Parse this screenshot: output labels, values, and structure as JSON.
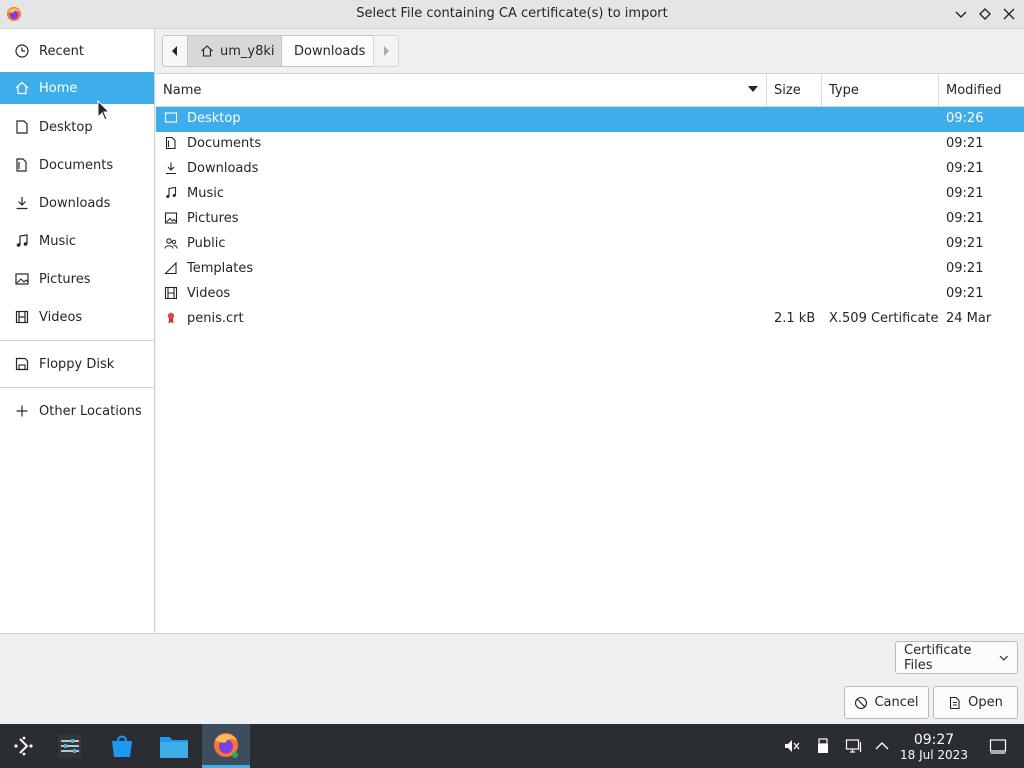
{
  "window": {
    "title": "Select File containing CA certificate(s) to import"
  },
  "sidebar": {
    "items": [
      {
        "label": "Recent",
        "icon": "clock-icon"
      },
      {
        "label": "Home",
        "icon": "home-icon"
      },
      {
        "label": "Desktop",
        "icon": "desktop-icon"
      },
      {
        "label": "Documents",
        "icon": "documents-icon"
      },
      {
        "label": "Downloads",
        "icon": "download-icon"
      },
      {
        "label": "Music",
        "icon": "music-icon"
      },
      {
        "label": "Pictures",
        "icon": "pictures-icon"
      },
      {
        "label": "Videos",
        "icon": "videos-icon"
      },
      {
        "label": "Floppy Disk",
        "icon": "floppy-icon"
      },
      {
        "label": "Other Locations",
        "icon": "plus-icon"
      }
    ],
    "selected": "Home"
  },
  "pathbar": {
    "crumbs": [
      "um_y8ki",
      "Downloads"
    ]
  },
  "filelist": {
    "columns": [
      "Name",
      "Size",
      "Type",
      "Modified"
    ],
    "rows": [
      {
        "name": "Desktop",
        "size": "",
        "type": "",
        "modified": "09:26",
        "icon": "desktop-icon"
      },
      {
        "name": "Documents",
        "size": "",
        "type": "",
        "modified": "09:21",
        "icon": "documents-icon"
      },
      {
        "name": "Downloads",
        "size": "",
        "type": "",
        "modified": "09:21",
        "icon": "download-icon"
      },
      {
        "name": "Music",
        "size": "",
        "type": "",
        "modified": "09:21",
        "icon": "music-icon"
      },
      {
        "name": "Pictures",
        "size": "",
        "type": "",
        "modified": "09:21",
        "icon": "pictures-icon"
      },
      {
        "name": "Public",
        "size": "",
        "type": "",
        "modified": "09:21",
        "icon": "public-icon"
      },
      {
        "name": "Templates",
        "size": "",
        "type": "",
        "modified": "09:21",
        "icon": "templates-icon"
      },
      {
        "name": "Videos",
        "size": "",
        "type": "",
        "modified": "09:21",
        "icon": "videos-icon"
      },
      {
        "name": "penis.crt",
        "size": "2.1 kB",
        "type": "X.509 Certificate",
        "modified": "24 Mar",
        "icon": "certificate-icon"
      }
    ],
    "selected_row": "Desktop"
  },
  "bottom": {
    "filter": "Certificate Files",
    "cancel_label": "Cancel",
    "open_label": "Open"
  },
  "taskbar": {
    "time": "09:27",
    "date": "18 Jul 2023"
  },
  "colors": {
    "accent": "#3daee9",
    "taskbar": "#2a2e32",
    "background": "#eff0f1"
  }
}
